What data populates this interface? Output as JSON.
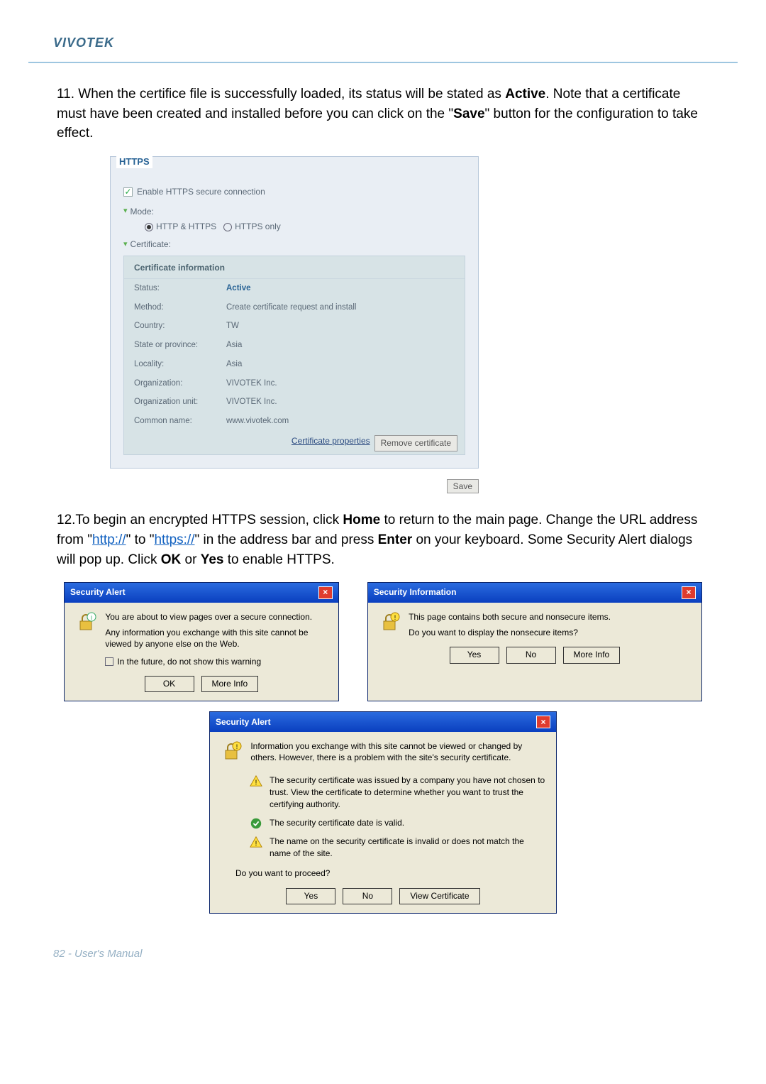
{
  "header": {
    "brand": "VIVOTEK"
  },
  "para11": {
    "prefix": "11. When the certifice file is successfully loaded, its status will be stated as ",
    "active": "Active",
    "mid": ". Note that a certificate must have been created and installed before you can click on the \"",
    "save": "Save",
    "suffix": "\" button for the configuration to take effect."
  },
  "https": {
    "legend": "HTTPS",
    "enable": "Enable HTTPS secure connection",
    "mode_label": "Mode:",
    "mode1": "HTTP & HTTPS",
    "mode2": "HTTPS only",
    "cert_label": "Certificate:",
    "cert_header": "Certificate information",
    "rows": [
      {
        "k": "Status:",
        "v": "Active",
        "color": "#2a6496",
        "bold": true
      },
      {
        "k": "Method:",
        "v": "Create certificate request and install"
      },
      {
        "k": "Country:",
        "v": "TW"
      },
      {
        "k": "State or province:",
        "v": "Asia"
      },
      {
        "k": "Locality:",
        "v": "Asia"
      },
      {
        "k": "Organization:",
        "v": "VIVOTEK Inc."
      },
      {
        "k": "Organization unit:",
        "v": "VIVOTEK Inc."
      },
      {
        "k": "Common name:",
        "v": "www.vivotek.com"
      }
    ],
    "props_btn": "Certificate properties",
    "remove_btn": "Remove certificate",
    "save_btn": "Save"
  },
  "para12": {
    "p1a": "12.To begin an encrypted HTTPS session, click ",
    "home": "Home",
    "p1b": " to return to the main page. Change the URL address from \"",
    "http": "http://",
    "p1c": "\" to \"",
    "https": "https://",
    "p1d": "\" in the address bar and press ",
    "enter": "Enter",
    "p1e": " on your keyboard. Some Security Alert dialogs will pop up. Click ",
    "ok": "OK",
    "or": " or ",
    "yes": "Yes",
    "p1f": " to enable HTTPS."
  },
  "dlg1": {
    "title": "Security Alert",
    "msg1": "You are about to view pages over a secure connection.",
    "msg2": "Any information you exchange with this site cannot be viewed by anyone else on the Web.",
    "chk": "In the future, do not show this warning",
    "ok": "OK",
    "more": "More Info"
  },
  "dlg2": {
    "title": "Security Information",
    "msg1": "This page contains both secure and nonsecure items.",
    "msg2": "Do you want to display the nonsecure items?",
    "yes": "Yes",
    "no": "No",
    "more": "More Info"
  },
  "dlg3": {
    "title": "Security Alert",
    "intro": "Information you exchange with this site cannot be viewed or changed by others. However, there is a problem with the site's security certificate.",
    "w1": "The security certificate was issued by a company you have not chosen to trust. View the certificate to determine whether you want to trust the certifying authority.",
    "w2": "The security certificate date is valid.",
    "w3": "The name on the security certificate is invalid or does not match the name of the site.",
    "q": "Do you want to proceed?",
    "yes": "Yes",
    "no": "No",
    "view": "View Certificate"
  },
  "footer": "82 - User's Manual"
}
